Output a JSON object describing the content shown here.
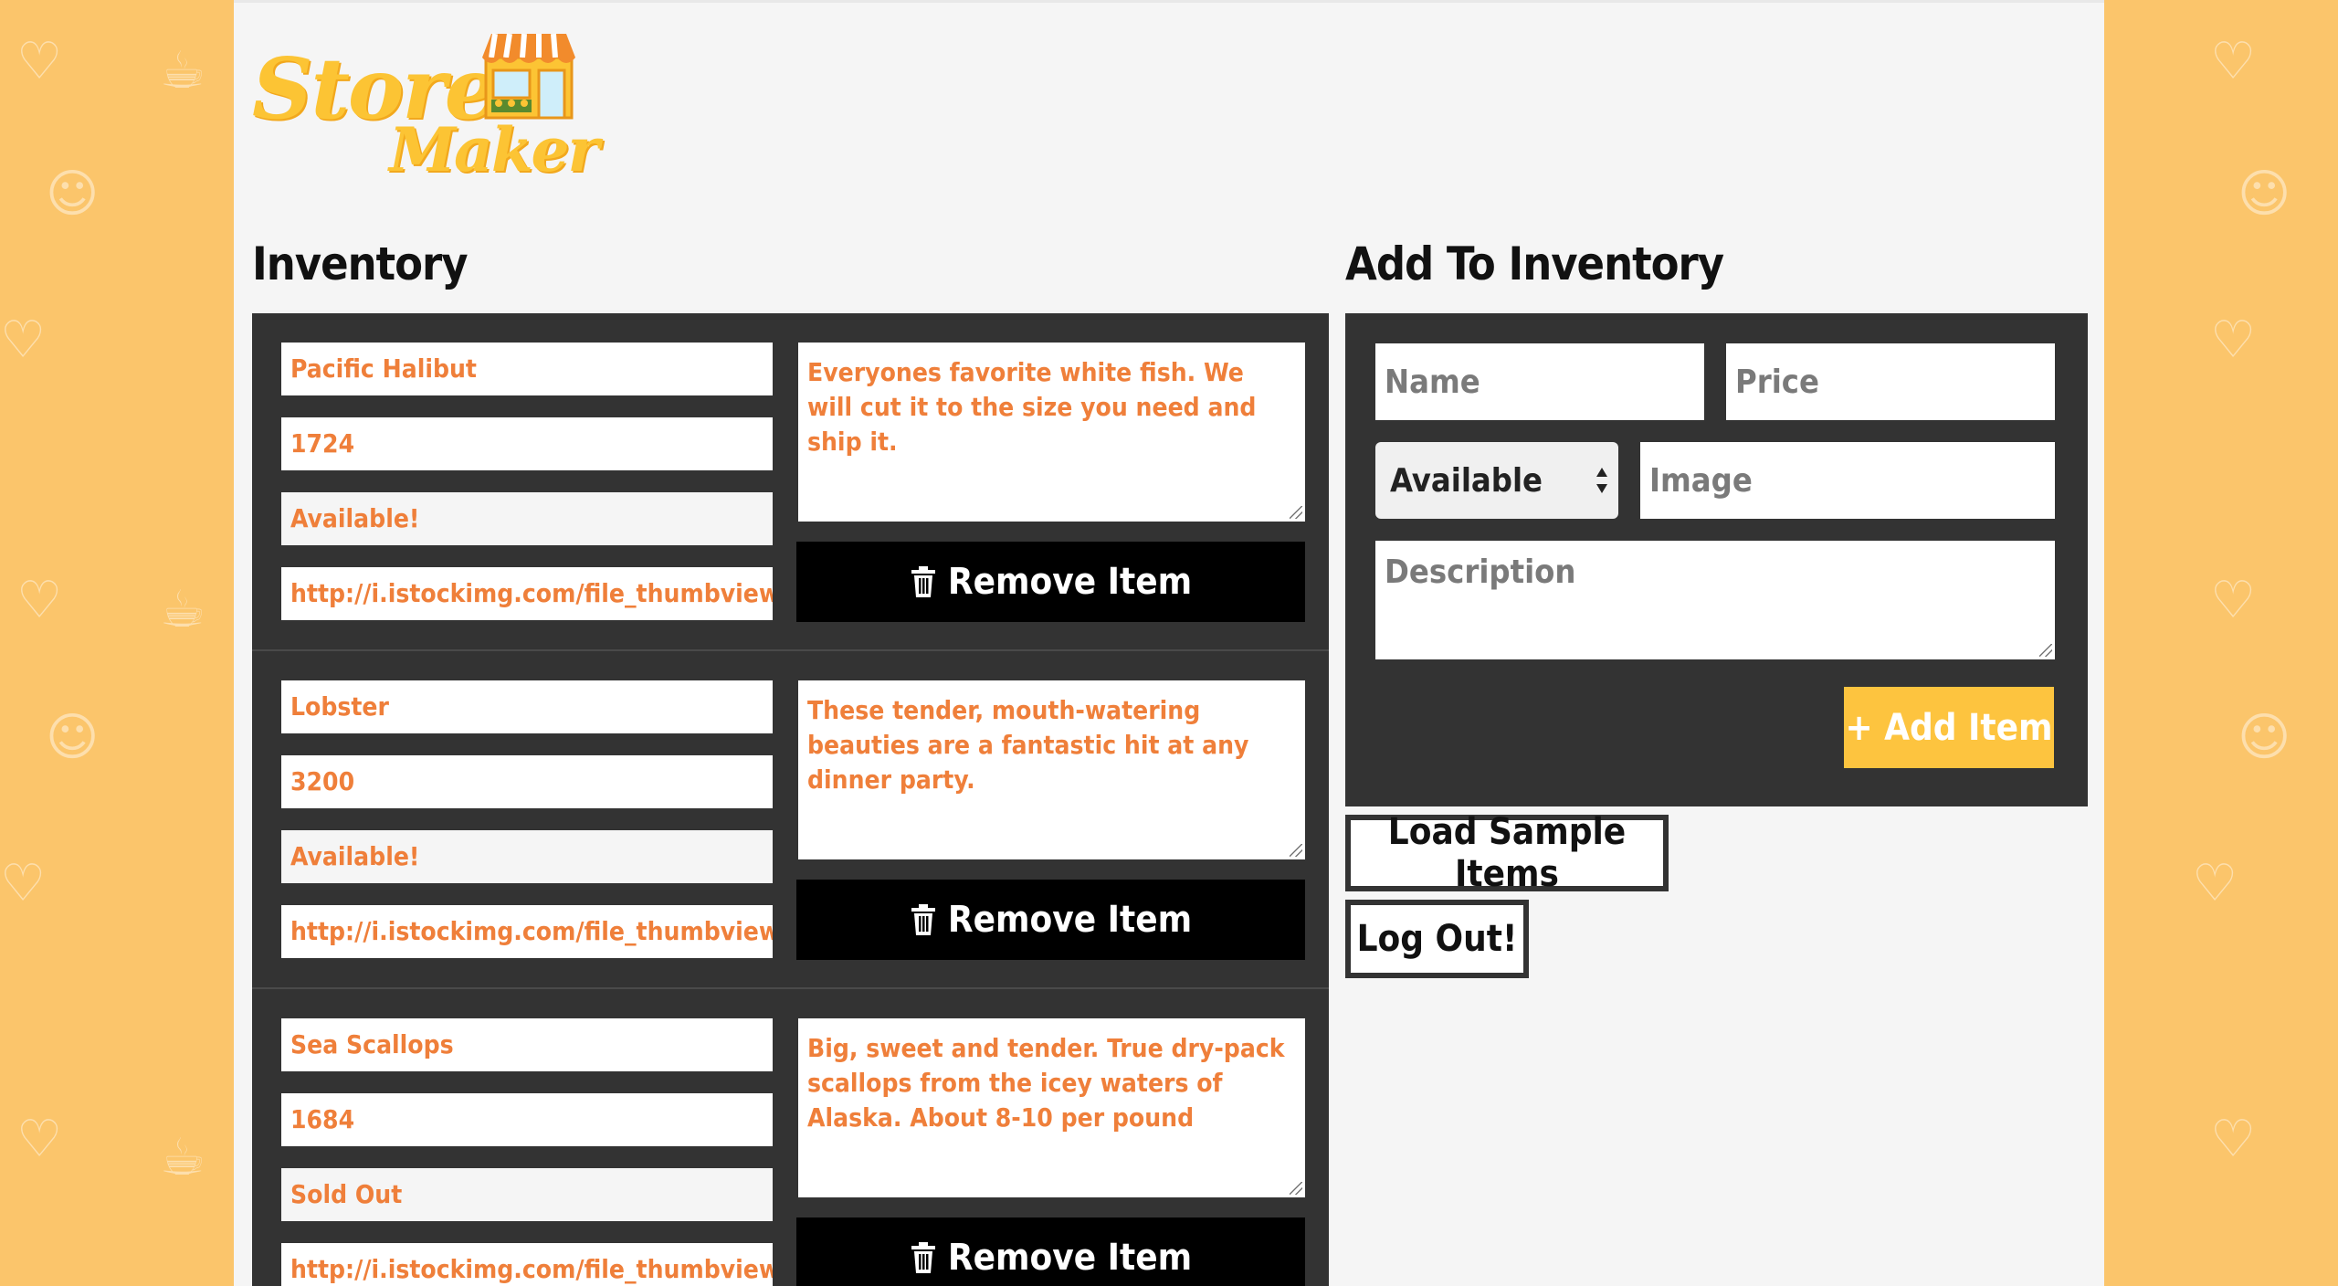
{
  "brand": {
    "logo_text": "Store Maker"
  },
  "inventory": {
    "title": "Inventory",
    "items": [
      {
        "name": "Pacific Halibut",
        "price": "1724",
        "status": "Available!",
        "image": "http://i.istockimg.com/file_thumbview_approve/36248396/5/stock-photo-36248396-blackened-cajun-sea-bass.jpg",
        "description": "Everyones favorite white fish. We will cut it to the size you need and ship it.",
        "remove_label": "Remove Item"
      },
      {
        "name": "Lobster",
        "price": "3200",
        "status": "Available!",
        "image": "http://i.istockimg.com/file_thumbview_approve/32135400/5/stock-photo-32135400-cooked-lobster.jpg",
        "description": "These tender, mouth-watering beauties are a fantastic hit at any dinner party.",
        "remove_label": "Remove Item"
      },
      {
        "name": "Sea Scallops",
        "price": "1684",
        "status": "Sold Out",
        "image": "http://i.istockimg.com/file_thumbview_approve/58624176/5/stock-photo-58624176-scallops-on-black-stone-plate.jpg",
        "description": "Big, sweet and tender. True dry-pack scallops from the icey waters of Alaska. About 8-10 per pound",
        "remove_label": "Remove Item"
      }
    ]
  },
  "add_form": {
    "title": "Add To Inventory",
    "name_placeholder": "Name",
    "price_placeholder": "Price",
    "status_selected": "Available",
    "image_placeholder": "Image",
    "description_placeholder": "Description",
    "add_label": "+ Add Item"
  },
  "actions": {
    "load_samples_label": "Load Sample Items",
    "logout_label": "Log Out!"
  },
  "colors": {
    "background": "#fbc56b",
    "panel": "#333333",
    "accent_text": "#ef7f3a",
    "add_button": "#fdc43f"
  }
}
